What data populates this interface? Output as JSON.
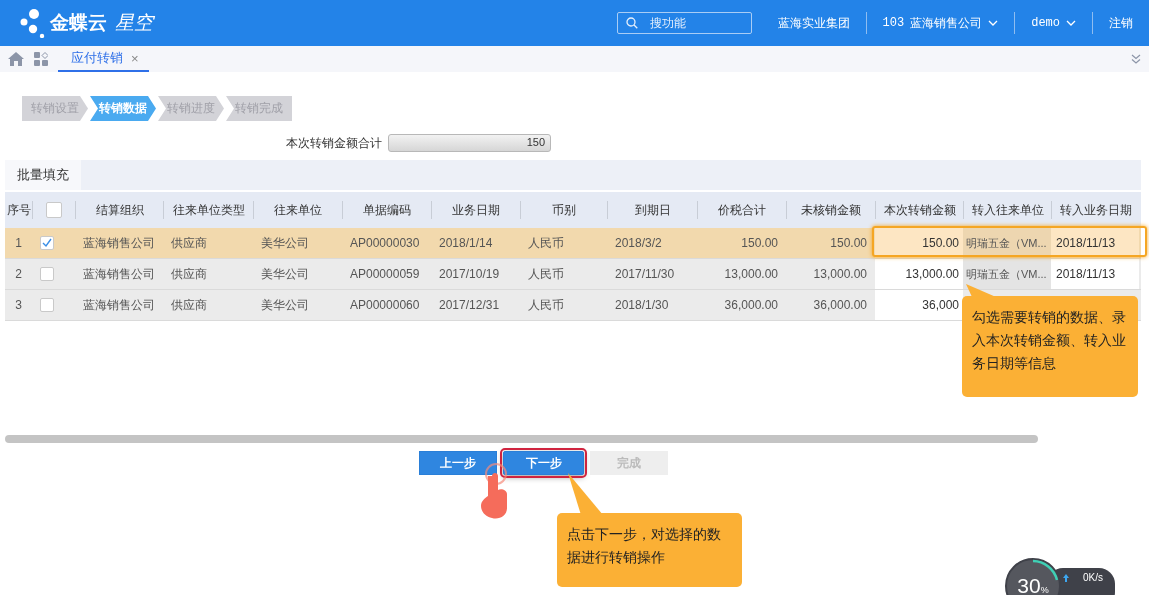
{
  "header": {
    "logo": "金蝶云",
    "logo_sub": "星空",
    "search": {
      "placeholder": "搜功能"
    },
    "group": "蓝海实业集团",
    "org_code": "103",
    "org": "蓝海销售公司",
    "user": "demo",
    "logout": "注销"
  },
  "tabs": [
    {
      "label": "应付转销",
      "close": "×",
      "selected": true
    }
  ],
  "steps": [
    {
      "label": "转销设置",
      "selected": false
    },
    {
      "label": "转销数据",
      "selected": true
    },
    {
      "label": "转销进度",
      "selected": false
    },
    {
      "label": "转销完成",
      "selected": false
    }
  ],
  "total": {
    "label": "本次转销金额合计",
    "value": "150"
  },
  "batch_fill": "批量填充",
  "table": {
    "all_checked": false,
    "columns": [
      {
        "label": "序号",
        "kind": "seq"
      },
      {
        "kind": "check"
      },
      {
        "label": "结算组织",
        "kind": "text"
      },
      {
        "label": "往来单位类型",
        "kind": "text"
      },
      {
        "label": "往来单位",
        "kind": "text"
      },
      {
        "label": "单据编码",
        "kind": "text"
      },
      {
        "label": "业务日期",
        "kind": "text"
      },
      {
        "label": "币别",
        "kind": "text"
      },
      {
        "label": "到期日",
        "kind": "text"
      },
      {
        "label": "价税合计",
        "kind": "number"
      },
      {
        "label": "未核销金额",
        "kind": "number"
      },
      {
        "label": "本次转销金额",
        "kind": "input"
      },
      {
        "label": "转入往来单位",
        "kind": "lookup"
      },
      {
        "label": "转入业务日期",
        "kind": "date"
      }
    ],
    "rows": [
      {
        "checked": true,
        "cells": [
          "1",
          "",
          "蓝海销售公司",
          "供应商",
          "美华公司",
          "AP00000030",
          "2018/1/14",
          "人民币",
          "2018/3/2",
          "150.00",
          "150.00",
          "150.00",
          "明瑞五金（VM...",
          "2018/11/13"
        ]
      },
      {
        "checked": false,
        "cells": [
          "2",
          "",
          "蓝海销售公司",
          "供应商",
          "美华公司",
          "AP00000059",
          "2017/10/19",
          "人民币",
          "2017/11/30",
          "13,000.00",
          "13,000.00",
          "13,000.00",
          "明瑞五金（VM...",
          "2018/11/13"
        ]
      },
      {
        "checked": false,
        "cells": [
          "3",
          "",
          "蓝海销售公司",
          "供应商",
          "美华公司",
          "AP00000060",
          "2017/12/31",
          "人民币",
          "2018/1/30",
          "36,000.00",
          "36,000.00",
          "36,000"
        ]
      }
    ]
  },
  "buttons": [
    {
      "label": "上一步",
      "disabled": false,
      "highlighted": false
    },
    {
      "label": "下一步",
      "disabled": false,
      "highlighted": true
    },
    {
      "label": "完成",
      "disabled": true,
      "highlighted": false
    }
  ],
  "callouts": [
    {
      "text": "勾选需要转销的数据、录入本次转销金额、转入业务日期等信息"
    },
    {
      "text": "点击下一步，对选择的数据进行转销操作"
    }
  ],
  "monitor": {
    "percent": "30",
    "unit": "%",
    "speed": "0K/s"
  }
}
